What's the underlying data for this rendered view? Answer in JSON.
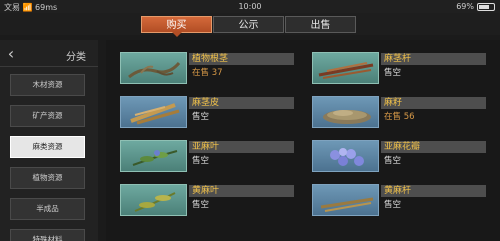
{
  "status_bar": {
    "carrier": "文易 📶 69ms",
    "time": "10:00",
    "battery_percent": "69%",
    "battery_level": 0.69
  },
  "tabs": [
    {
      "label": "购买",
      "active": true
    },
    {
      "label": "公示",
      "active": false
    },
    {
      "label": "出售",
      "active": false
    }
  ],
  "sidebar": {
    "title": "分类",
    "items": [
      {
        "label": "木材资源",
        "active": false
      },
      {
        "label": "矿产资源",
        "active": false
      },
      {
        "label": "麻类资源",
        "active": true
      },
      {
        "label": "植物资源",
        "active": false
      },
      {
        "label": "半成品",
        "active": false
      },
      {
        "label": "特殊材料",
        "active": false
      }
    ]
  },
  "items": [
    {
      "name": "植物根茎",
      "status": "在售 37",
      "on_sale": true
    },
    {
      "name": "麻茎杆",
      "status": "售空",
      "on_sale": false
    },
    {
      "name": "麻茎皮",
      "status": "售空",
      "on_sale": false
    },
    {
      "name": "麻籽",
      "status": "在售 56",
      "on_sale": true
    },
    {
      "name": "亚麻叶",
      "status": "售空",
      "on_sale": false
    },
    {
      "name": "亚麻花瓣",
      "status": "售空",
      "on_sale": false
    },
    {
      "name": "黄麻叶",
      "status": "售空",
      "on_sale": false
    },
    {
      "name": "黄麻杆",
      "status": "售空",
      "on_sale": false
    }
  ],
  "colors": {
    "accent": "#c85a2e",
    "item_name": "#f3c34a",
    "on_sale": "#d89a48"
  }
}
